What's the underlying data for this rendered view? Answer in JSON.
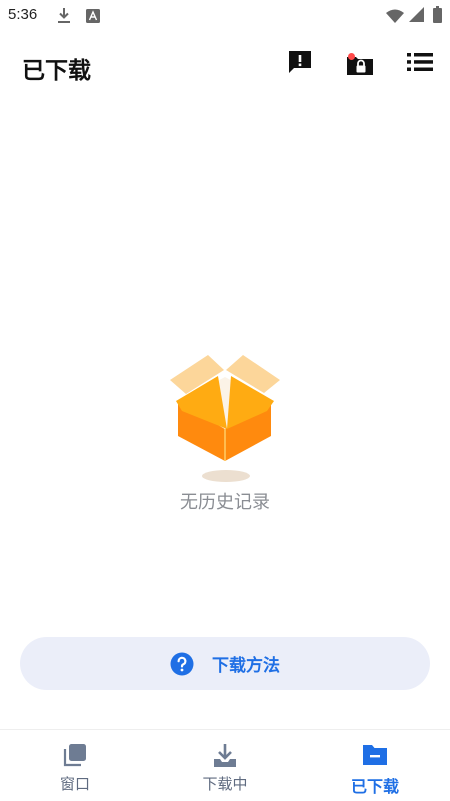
{
  "status_bar": {
    "time": "5:36",
    "icons": [
      "download-icon",
      "a-notification-icon",
      "wifi-icon",
      "signal-icon",
      "battery-icon"
    ]
  },
  "app_bar": {
    "title": "已下载",
    "actions": [
      "feedback-icon",
      "private-folder-icon",
      "list-menu-icon"
    ],
    "notification_dot_color": "#ff4a4a"
  },
  "empty_state": {
    "illustration": "open-box-icon",
    "text": "无历史记录"
  },
  "help": {
    "icon": "question-icon",
    "label": "下载方法"
  },
  "bottom_nav": {
    "items": [
      {
        "label": "窗口",
        "icon": "window-icon",
        "active": false
      },
      {
        "label": "下载中",
        "icon": "download-tray-icon",
        "active": false
      },
      {
        "label": "已下载",
        "icon": "downloaded-folder-icon",
        "active": true
      }
    ]
  },
  "colors": {
    "accent": "#1f6fe5",
    "help_background": "#ebeef9",
    "empty_text": "#8a8d93",
    "nav_inactive": "#5f6b80"
  }
}
